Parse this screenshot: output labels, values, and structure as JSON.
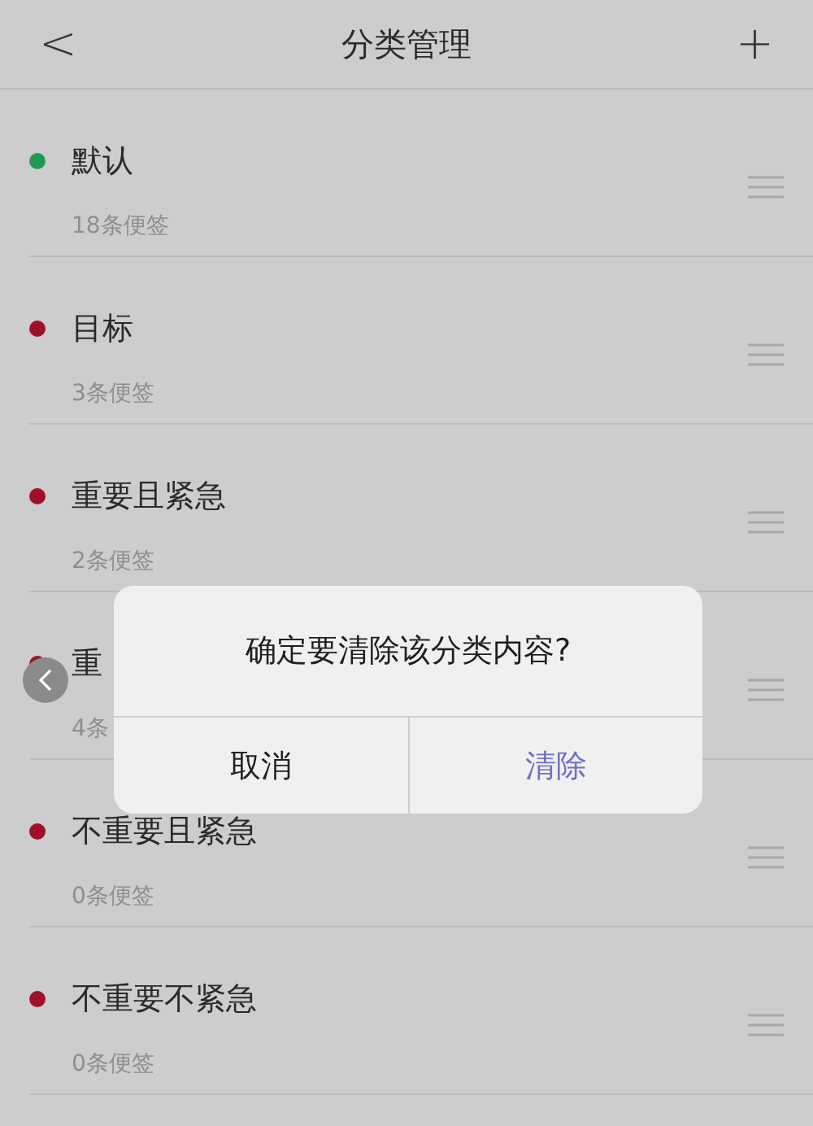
{
  "header": {
    "back": "<",
    "title": "分类管理",
    "add": "+"
  },
  "categories": [
    {
      "name": "默认",
      "count": "18条便签",
      "color": "#1e9a55"
    },
    {
      "name": "目标",
      "count": "3条便签",
      "color": "#a0102a"
    },
    {
      "name": "重要且紧急",
      "count": "2条便签",
      "color": "#a0102a"
    },
    {
      "name": "重",
      "count": "4条",
      "color": "#a0102a"
    },
    {
      "name": "不重要且紧急",
      "count": "0条便签",
      "color": "#a0102a"
    },
    {
      "name": "不重要不紧急",
      "count": "0条便签",
      "color": "#a0102a"
    }
  ],
  "dialog": {
    "message": "确定要清除该分类内容?",
    "buttons": [
      {
        "label": "取消",
        "kind": "cancel"
      },
      {
        "label": "清除",
        "kind": "confirm"
      }
    ]
  }
}
